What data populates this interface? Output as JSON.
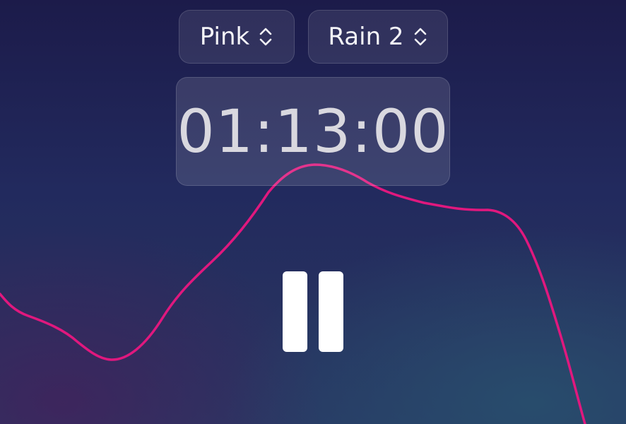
{
  "noise_selector": {
    "label": "Pink",
    "icon": "chevron-up-down-icon"
  },
  "sound_selector": {
    "label": "Rain 2",
    "icon": "chevron-up-down-icon"
  },
  "timer": {
    "value": "01:13:00"
  },
  "playback": {
    "state": "playing",
    "button_icon": "pause-icon"
  },
  "colors": {
    "wave": "#e0187e",
    "text": "#f4f4f8",
    "timer_text": "#d9d8df",
    "background_top": "#1c1b4a",
    "background_bottom": "#283864"
  }
}
